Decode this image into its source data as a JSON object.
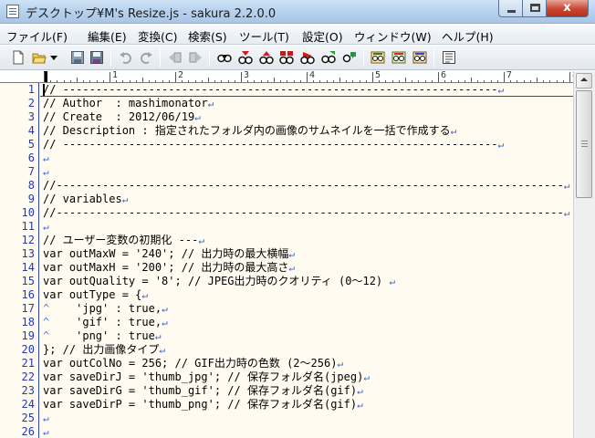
{
  "window": {
    "title": "デスクトップ¥M's Resize.js - sakura 2.2.0.0",
    "close_glyph": "x"
  },
  "menu": [
    "ファイル(F)",
    "編集(E)",
    "変換(C)",
    "検索(S)",
    "ツール(T)",
    "設定(O)",
    "ウィンドウ(W)",
    "ヘルプ(H)"
  ],
  "toolbar": [
    "new-file-icon",
    "open-file-icon",
    "open-dropdown-icon",
    "save-icon",
    "save-all-icon",
    "undo-icon",
    "redo-icon",
    "back-icon",
    "forward-icon",
    "search-icon",
    "search-prev-icon",
    "search-next-icon",
    "replace-icon",
    "highlight-icon",
    "jump-icon",
    "grep-icon",
    "grep-replace-icon",
    "tag-jump-icon",
    "outline-icon"
  ],
  "ruler": {
    "labels": [
      "1",
      "2",
      "3",
      "4",
      "5",
      "6",
      "7",
      "8"
    ]
  },
  "editor": {
    "lines": [
      {
        "n": "1",
        "text": "// ------------------------------------------------------------------"
      },
      {
        "n": "2",
        "text": "// Author  : mashimonator"
      },
      {
        "n": "3",
        "text": "// Create  : 2012/06/19"
      },
      {
        "n": "4",
        "text": "// Description : 指定されたフォルダ内の画像のサムネイルを一括で作成する"
      },
      {
        "n": "5",
        "text": "// ------------------------------------------------------------------"
      },
      {
        "n": "6",
        "text": ""
      },
      {
        "n": "7",
        "text": ""
      },
      {
        "n": "8",
        "text": "//-----------------------------------------------------------------------------"
      },
      {
        "n": "9",
        "text": "// variables"
      },
      {
        "n": "10",
        "text": "//-----------------------------------------------------------------------------"
      },
      {
        "n": "11",
        "text": ""
      },
      {
        "n": "12",
        "text": "// ユーザー変数の初期化 ---"
      },
      {
        "n": "13",
        "text": "var outMaxW = '240'; // 出力時の最大横幅"
      },
      {
        "n": "14",
        "text": "var outMaxH = '200'; // 出力時の最大高さ"
      },
      {
        "n": "15",
        "text": "var outQuality = '8'; // JPEG出力時のクオリティ (0～12) "
      },
      {
        "n": "16",
        "text": "var outType = {"
      },
      {
        "n": "17",
        "text": "    'jpg' : true,",
        "tab": true
      },
      {
        "n": "18",
        "text": "    'gif' : true,",
        "tab": true
      },
      {
        "n": "19",
        "text": "    'png' : true",
        "tab": true
      },
      {
        "n": "20",
        "text": "}; // 出力画像タイプ"
      },
      {
        "n": "21",
        "text": "var outColNo = 256; // GIF出力時の色数 (2～256)"
      },
      {
        "n": "22",
        "text": "var saveDirJ = 'thumb_jpg'; // 保存フォルダ名(jpeg)"
      },
      {
        "n": "23",
        "text": "var saveDirG = 'thumb_gif'; // 保存フォルダ名(gif)"
      },
      {
        "n": "24",
        "text": "var saveDirP = 'thumb_png'; // 保存フォルダ名(gif)"
      },
      {
        "n": "25",
        "text": ""
      },
      {
        "n": "26",
        "text": ""
      }
    ],
    "eol_mark": "↵",
    "tab_mark": "^"
  },
  "colors": {
    "editor_bg": "#fffbf0",
    "line_number": "#2438b4",
    "eol_mark": "#3a5fd0"
  }
}
